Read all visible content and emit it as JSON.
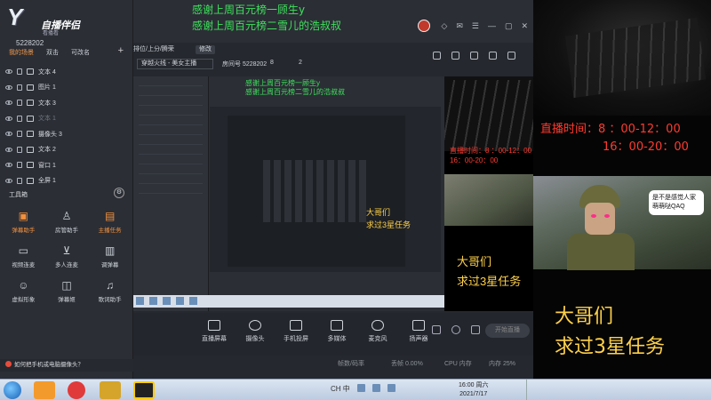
{
  "left_panel": {
    "logo_big": "Y",
    "logo_small": "自播伴侣",
    "logo_sub": "看播看",
    "room_id": "5228202",
    "scene_tabs": [
      "我的场景",
      "双击",
      "可改名"
    ],
    "add_label": "+",
    "sources": [
      {
        "label": "文本 4",
        "icon": "text-icon",
        "dim": false
      },
      {
        "label": "图片 1",
        "icon": "image-icon",
        "dim": false
      },
      {
        "label": "文本 3",
        "icon": "text-icon",
        "dim": false
      },
      {
        "label": "文本 1",
        "icon": "text-icon",
        "dim": true
      },
      {
        "label": "摄像头 3",
        "icon": "camera-icon",
        "dim": false
      },
      {
        "label": "文本 2",
        "icon": "text-icon",
        "dim": false
      },
      {
        "label": "窗口 1",
        "icon": "window-icon",
        "dim": false
      },
      {
        "label": "全屏 1",
        "icon": "fullscreen-icon",
        "dim": false
      }
    ],
    "tools_heading": "工具箱",
    "tools": [
      {
        "label": "弹幕助手",
        "icon": "danmaku-icon",
        "hot": true
      },
      {
        "label": "房管助手",
        "icon": "admin-icon",
        "hot": false
      },
      {
        "label": "主播任务",
        "icon": "task-icon",
        "hot": true
      },
      {
        "label": "视频连麦",
        "icon": "video-link-icon",
        "hot": false
      },
      {
        "label": "多人连麦",
        "icon": "multi-link-icon",
        "hot": false
      },
      {
        "label": "调弹幕",
        "icon": "adjust-danmaku-icon",
        "hot": false
      },
      {
        "label": "虚拟形象",
        "icon": "avatar-icon",
        "hot": false
      },
      {
        "label": "弹幕姬",
        "icon": "danmaku-ji-icon",
        "hot": false
      },
      {
        "label": "歌词助手",
        "icon": "lyrics-icon",
        "hot": false
      }
    ],
    "tip": "如何把手机或电脑摄像头？"
  },
  "center": {
    "thanks_line1": "感谢上周百元榜一顾生y",
    "thanks_line2": "感谢上周百元榜二雪儿的浩叔叔",
    "rank_label": "排位/上分/腾荣",
    "edit_label": "修改",
    "category": "穿越火线 - 美女主播",
    "room_label": "房间号 5228202",
    "count1": "8",
    "count2": "2",
    "bottom_items": [
      {
        "label": "直播屏幕",
        "icon": "screen-icon"
      },
      {
        "label": "摄像头",
        "icon": "camera-icon"
      },
      {
        "label": "手机投屏",
        "icon": "phone-cast-icon"
      },
      {
        "label": "多媒体",
        "icon": "media-icon"
      },
      {
        "label": "麦克风",
        "icon": "mic-icon"
      },
      {
        "label": "扬声器",
        "icon": "speaker-icon"
      }
    ],
    "start_live": "开始直播",
    "status_items": [
      "帧数/码率",
      "丢帧 0.00%",
      "CPU 内存",
      "内存 25%"
    ]
  },
  "stream_overlay": {
    "schedule_line1": "直播时间：8 ：00-12：00",
    "schedule_line2": "16：00-20：00",
    "cta_line1": "大哥们",
    "cta_line2": "求过3星任务",
    "bubble_text": "是不是感觉人家萌萌哒QAQ"
  },
  "taskbar": {
    "clock_time": "16:00 周六",
    "clock_date": "2021/7/17",
    "tray_lang": "CH 中"
  }
}
